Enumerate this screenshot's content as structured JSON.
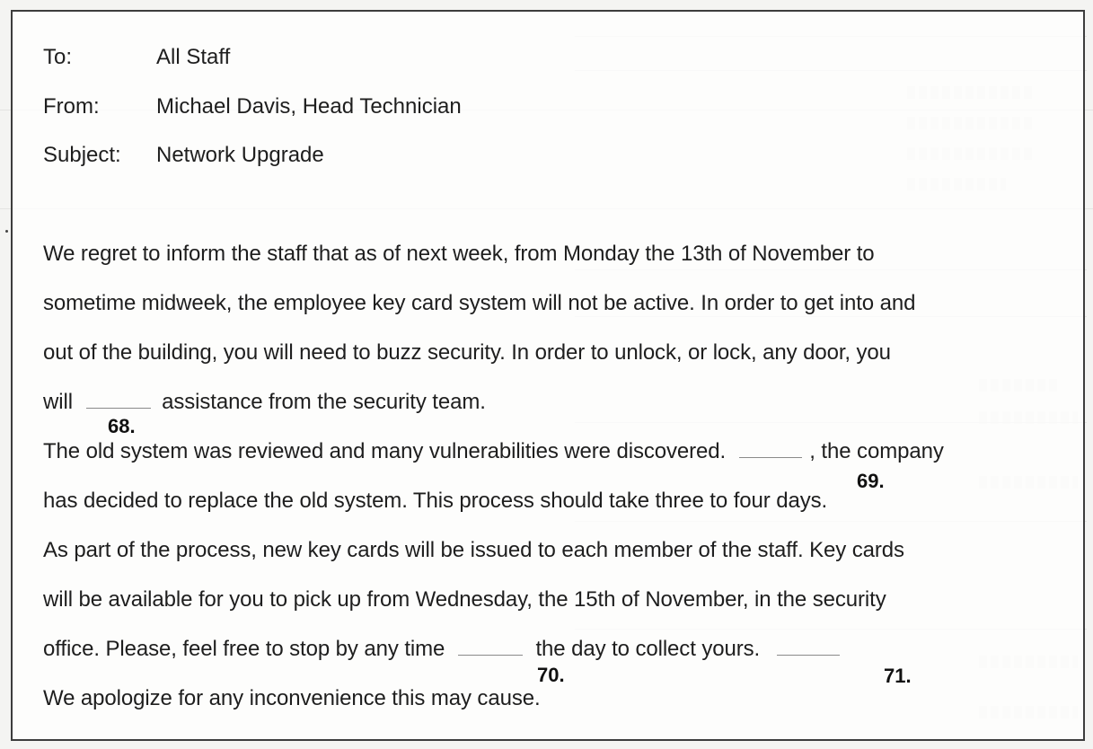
{
  "memo": {
    "header": {
      "to_label": "To:",
      "to_value": "All Staff",
      "from_label": "From:",
      "from_value": "Michael Davis, Head Technician",
      "subject_label": "Subject:",
      "subject_value": "Network Upgrade"
    },
    "body": {
      "p1_line1": "We regret to inform the staff that as of next week, from Monday the 13th of November to",
      "p1_line2": "sometime midweek, the employee key card system will not be active. In order to get into and",
      "p1_line3": "out of the building, you will need to buzz security. In order to unlock, or lock, any door, you",
      "p1_line4_before": "will",
      "p1_line4_after": "assistance from the security team.",
      "p2_line1_before": "The old system was reviewed and many vulnerabilities were discovered.",
      "p2_line1_after": ", the company",
      "p2_line2": "has decided to replace the old system. This process should take three to four days.",
      "p3_line1": "As part of the process, new key cards will be issued to each member of the staff. Key cards",
      "p3_line2": "will be available for you to pick up from Wednesday, the 15th of November, in the security",
      "p3_line3_before": "office. Please, feel free to stop by any time",
      "p3_line3_after": "the day to collect yours.",
      "p4_line1": "We apologize for any inconvenience this may cause."
    },
    "question_numbers": {
      "q68": "68.",
      "q69": "69.",
      "q70": "70.",
      "q71": "71."
    }
  },
  "colors": {
    "frame_border": "#3d3d3d",
    "text": "#1e1e1e",
    "blank_line": "#8a8a8a",
    "page_background": "#f4f4f2"
  }
}
